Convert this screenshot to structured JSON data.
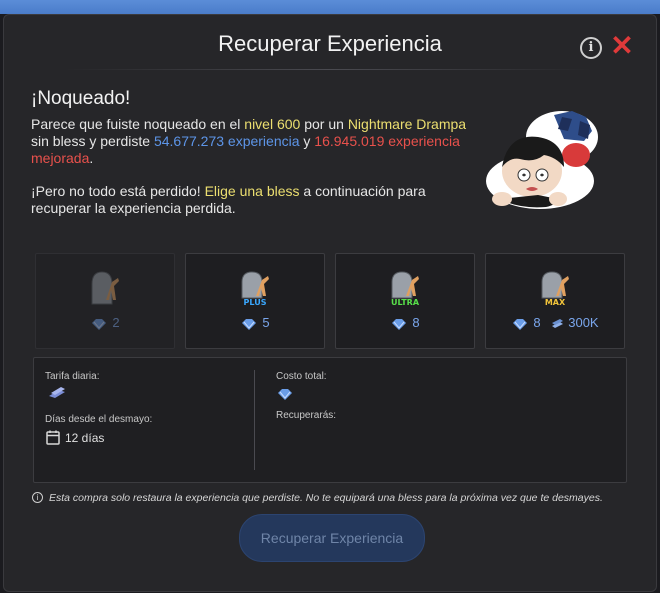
{
  "dialog": {
    "title": "Recuperar Experiencia",
    "info_icon_glyph": "i",
    "close_icon_glyph": "✕"
  },
  "message": {
    "headline": "¡Noqueado!",
    "p1_a": "Parece que fuiste noqueado en el ",
    "level": "nivel 600",
    "p1_b": " por un ",
    "monster": "Nightmare Drampa",
    "p1_c": "sin bless y perdiste ",
    "exp_lost": "54.677.273 experiencia",
    "p1_d": " y ",
    "enhanced_lost": "16.945.019 experiencia mejorada",
    "p1_e": ".",
    "p2_a": "¡Pero no todo está perdido! ",
    "p2_highlight": "Elige una bless",
    "p2_b": " a continuación para recuperar la experiencia perdida."
  },
  "options": [
    {
      "tier": "",
      "gems": "2",
      "extra": "",
      "state": "disabled"
    },
    {
      "tier": "PLUS",
      "gems": "5",
      "extra": "",
      "state": "available"
    },
    {
      "tier": "ULTRA",
      "gems": "8",
      "extra": "",
      "state": "available"
    },
    {
      "tier": "MAX",
      "gems": "8",
      "extra": "300K",
      "state": "available"
    }
  ],
  "summary": {
    "daily_rate_label": "Tarifa diaria:",
    "days_label": "Días desde el desmayo:",
    "days_value": "12 días",
    "total_cost_label": "Costo total:",
    "recover_label": "Recuperarás:"
  },
  "note": "Esta compra solo restaura la experiencia que perdiste. No te equipará una bless para la próxima vez que te desmayes.",
  "action_button": "Recuperar Experiencia",
  "colors": {
    "accent_yellow": "#ecdf70",
    "accent_blue": "#5d95e8",
    "accent_red": "#e8514c",
    "close_red": "#e03a3a",
    "plus": "#3aa8ff",
    "ultra": "#58e04a",
    "max": "#f2c43a"
  },
  "icons": {
    "gem": "gem-icon",
    "calendar": "calendar-icon",
    "tombstone": "tombstone-icon",
    "coins": "coin-stack-icon"
  }
}
